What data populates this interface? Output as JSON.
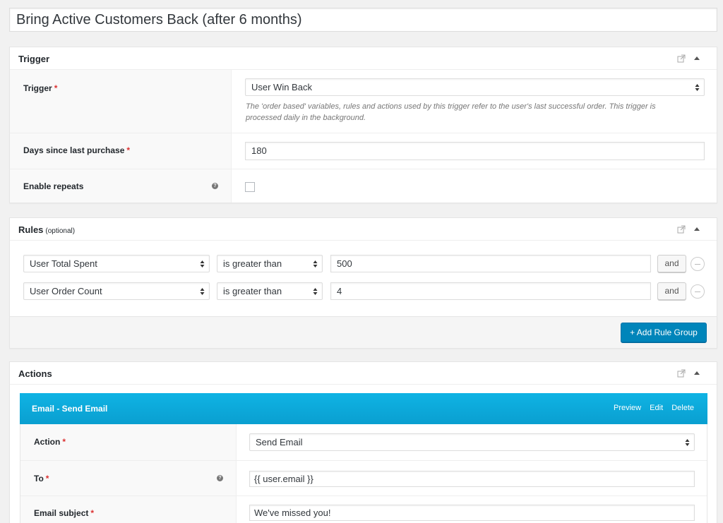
{
  "workflow": {
    "title": "Bring Active Customers Back (after 6 months)"
  },
  "trigger_box": {
    "title": "Trigger",
    "trigger_label": "Trigger",
    "trigger_value": "User Win Back",
    "trigger_desc_line1": "The 'order based' variables, rules and actions used by this trigger refer to the user's last successful order. This trigger is",
    "trigger_desc_line2": "processed daily in the background.",
    "days_label": "Days since last purchase",
    "days_value": "180",
    "repeats_label": "Enable repeats",
    "required_mark": "*",
    "help_glyph": "?"
  },
  "rules_box": {
    "title": "Rules",
    "optional": "(optional)",
    "rules": [
      {
        "field": "User Total Spent",
        "operator": "is greater than",
        "value": "500",
        "connector": "and"
      },
      {
        "field": "User Order Count",
        "operator": "is greater than",
        "value": "4",
        "connector": "and"
      }
    ],
    "add_group_label": "+ Add Rule Group"
  },
  "actions_box": {
    "title": "Actions",
    "action_title": "Email - Send Email",
    "links": {
      "preview": "Preview",
      "edit": "Edit",
      "delete": "Delete"
    },
    "action_label": "Action",
    "action_value": "Send Email",
    "to_label": "To",
    "to_value": "{{ user.email }}",
    "subject_label": "Email subject",
    "subject_value": "We've missed you!"
  },
  "colors": {
    "accent": "#0085ba",
    "action_header": "#0fb3e4",
    "required": "#dc3232"
  }
}
